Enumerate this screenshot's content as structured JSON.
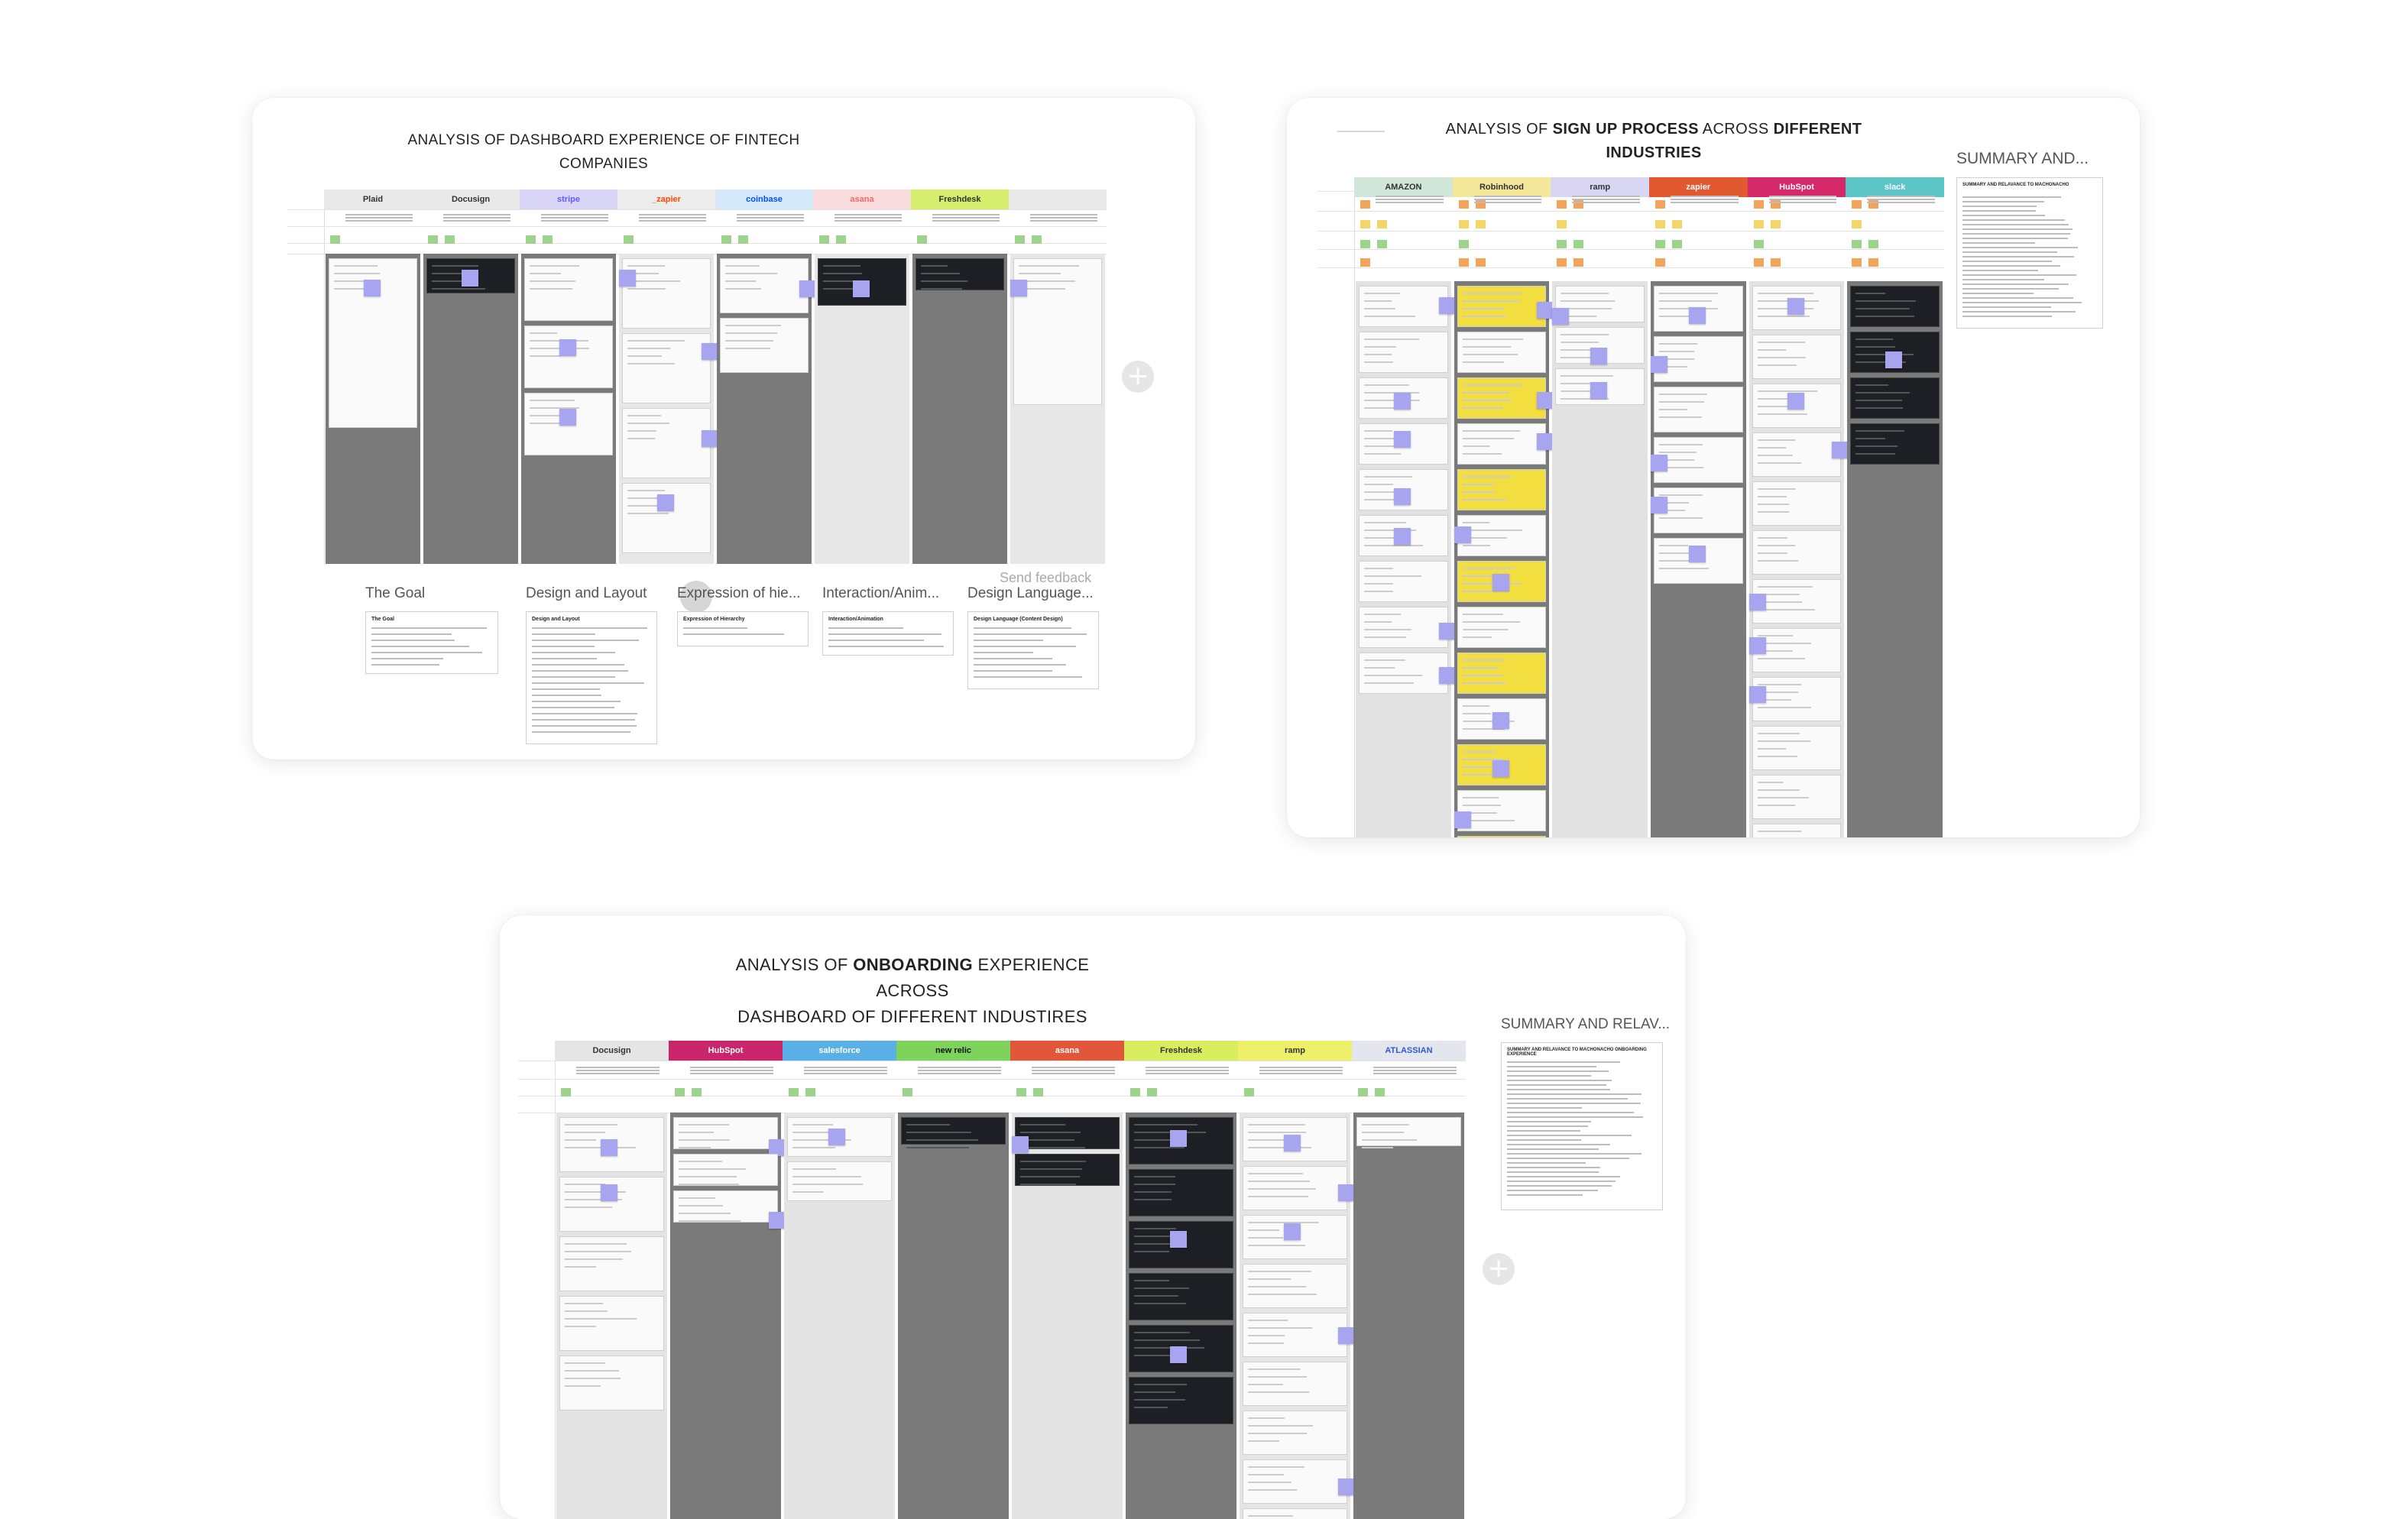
{
  "boards": {
    "dashboard": {
      "title_parts": [
        "ANALYSIS OF DASHBOARD EXPERIENCE OF FINTECH",
        "COMPANIES"
      ],
      "columns": [
        {
          "name": "Plaid",
          "color": "#e9e9e9",
          "text_color": "#333333"
        },
        {
          "name": "Docusign",
          "color": "#e9e9e9",
          "text_color": "#333333"
        },
        {
          "name": "stripe",
          "color": "#d8d5f7",
          "text_color": "#635bff"
        },
        {
          "name": "_zapier",
          "color": "#ececec",
          "text_color": "#ff4a00"
        },
        {
          "name": "coinbase",
          "color": "#d6e9fb",
          "text_color": "#0052ff"
        },
        {
          "name": "asana",
          "color": "#fbdcdc",
          "text_color": "#f06a6a"
        },
        {
          "name": "Freshdesk",
          "color": "#d5ee6e",
          "text_color": "#333333"
        },
        {
          "name": "",
          "color": "#e9e9e9",
          "text_color": "#333333"
        }
      ],
      "frames": [
        {
          "title": "The Goal",
          "doc_title": "The Goal"
        },
        {
          "title": "Design and Layout",
          "doc_title": "Design and Layout"
        },
        {
          "title": "Expression of hie...",
          "doc_title": "Expression of Hierarchy"
        },
        {
          "title": "Interaction/Anim...",
          "doc_title": "Interaction/Animation"
        },
        {
          "title": "Design Language...",
          "doc_title": "Design Language (Content Design)"
        }
      ],
      "send_feedback": "Send feedback",
      "add_icon": "plus-icon"
    },
    "signup": {
      "title_prefix": "ANALYSIS OF ",
      "title_bold1": "SIGN UP PROCESS",
      "title_mid": " ACROSS ",
      "title_bold2": "DIFFERENT INDUSTRIES",
      "summary_label": "SUMMARY AND...",
      "summary_doc_title": "SUMMARY AND RELAVANCE TO MACHONACHO",
      "columns": [
        {
          "name": "AMAZON",
          "color": "#cfe6d8",
          "text_color": "#333333"
        },
        {
          "name": "Robinhood",
          "color": "#f5e79a",
          "text_color": "#333333"
        },
        {
          "name": "ramp",
          "color": "#d9d6f5",
          "text_color": "#333333"
        },
        {
          "name": "zapier",
          "color": "#e2592f",
          "text_color": "#ffffff"
        },
        {
          "name": "HubSpot",
          "color": "#d6296a",
          "text_color": "#ffffff"
        },
        {
          "name": "slack",
          "color": "#5ac4c7",
          "text_color": "#ffffff"
        }
      ]
    },
    "onboarding": {
      "title_prefix": "ANALYSIS OF ",
      "title_bold": "ONBOARDING",
      "title_suffix": " EXPERIENCE ACROSS",
      "title_line2": "DASHBOARD OF DIFFERENT INDUSTIRES",
      "summary_label": "SUMMARY AND RELAV...",
      "summary_doc_title": "SUMMARY AND RELAVANCE TO MACHONACHO ONBOARDING EXPERIENCE",
      "columns": [
        {
          "name": "Docusign",
          "color": "#e5e5e5",
          "text_color": "#333333"
        },
        {
          "name": "HubSpot",
          "color": "#c9256a",
          "text_color": "#ffffff"
        },
        {
          "name": "salesforce",
          "color": "#5ab0e6",
          "text_color": "#ffffff"
        },
        {
          "name": "new relic",
          "color": "#7dd35c",
          "text_color": "#111111"
        },
        {
          "name": "asana",
          "color": "#e2573a",
          "text_color": "#ffffff"
        },
        {
          "name": "Freshdesk",
          "color": "#d8ee5e",
          "text_color": "#333333"
        },
        {
          "name": "ramp",
          "color": "#eef06a",
          "text_color": "#333333"
        },
        {
          "name": "ATLASSIAN",
          "color": "#e3e6ef",
          "text_color": "#2f5bd1"
        }
      ],
      "add_icon": "plus-icon"
    }
  },
  "colors": {
    "sticky_purple": "#a7a4f0",
    "column_gray": "#7a7a7a",
    "column_light": "#e4e4e4",
    "robinhood_yellow": "#f2de3f"
  }
}
